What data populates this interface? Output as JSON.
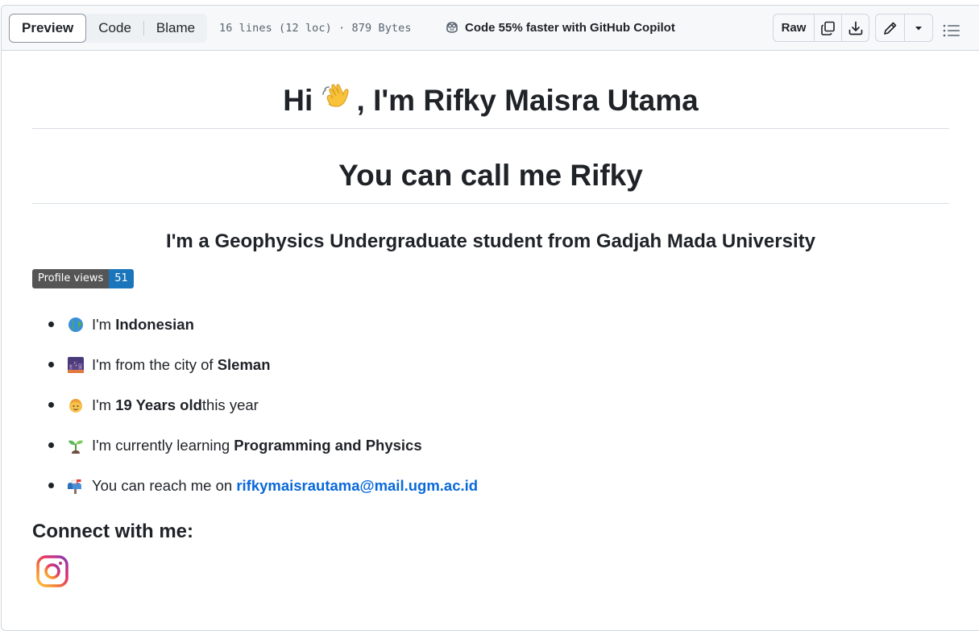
{
  "toolbar": {
    "tabs": [
      {
        "label": "Preview",
        "active": true
      },
      {
        "label": "Code",
        "active": false
      },
      {
        "label": "Blame",
        "active": false
      }
    ],
    "file_info": "16 lines (12 loc) · 879 Bytes",
    "copilot_text": "Code 55% faster with GitHub Copilot",
    "raw_label": "Raw",
    "icons": [
      "copilot-icon",
      "copy-icon",
      "download-icon",
      "pencil-icon",
      "chevron-down-icon",
      "list-icon"
    ]
  },
  "readme": {
    "title_before": "Hi",
    "title_after": ", I'm Rifky Maisra Utama",
    "subtitle": "You can call me Rifky",
    "tagline": "I'm a Geophysics Undergraduate student from Gadjah Mada University",
    "badge": {
      "label": "Profile views",
      "value": "51"
    },
    "items": [
      {
        "icon": "globe-icon",
        "pre": "I'm ",
        "bold": "Indonesian",
        "post": ""
      },
      {
        "icon": "city-icon",
        "pre": "I'm from the city of ",
        "bold": "Sleman",
        "post": ""
      },
      {
        "icon": "child-icon",
        "pre": "I'm ",
        "bold": "19 Years old",
        "post": " this year"
      },
      {
        "icon": "seedling-icon",
        "pre": "I'm currently learning ",
        "bold": "Programming and Physics",
        "post": ""
      },
      {
        "icon": "mailbox-icon",
        "pre": "You can reach me on ",
        "link": "rifkymaisrautama@mail.ugm.ac.id"
      }
    ],
    "connect_heading": "Connect with me:",
    "social": [
      "instagram-icon"
    ]
  },
  "colors": {
    "link": "#0969da",
    "badge_left": "#555555",
    "badge_right": "#1b75bb",
    "border": "#d0d7de"
  }
}
